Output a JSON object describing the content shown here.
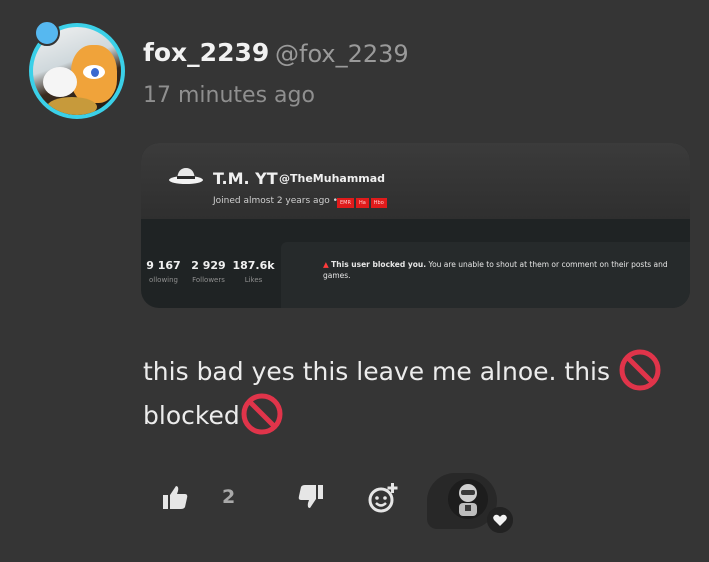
{
  "post": {
    "username": "fox_2239",
    "handle": "@fox_2239",
    "time": "17 minutes ago",
    "body_line1": "this  bad yes this leave me alnoe. this",
    "body_line2": "blocked"
  },
  "embedded_screenshot": {
    "name": "T.M. YT",
    "handle": "@TheMuhammad",
    "joined": "Joined almost 2 years ago  •",
    "tags": [
      "EMR",
      "Ha",
      "Hbo"
    ],
    "stats": [
      {
        "value": "9 167",
        "label": "ollowing"
      },
      {
        "value": "2 929",
        "label": "Followers"
      },
      {
        "value": "187.6k",
        "label": "Likes"
      }
    ],
    "warning_bold": "This user blocked you.",
    "warning_rest": " You are unable to shout at them or comment on their posts and games."
  },
  "actions": {
    "like_count": "2"
  },
  "colors": {
    "background": "#353535",
    "avatar_ring": "#3bd0e8",
    "no_entry": "#e0344a"
  },
  "icons": [
    "thumbs-up-icon",
    "thumbs-down-icon",
    "add-reaction-icon",
    "no-entry-icon",
    "heart-icon"
  ]
}
